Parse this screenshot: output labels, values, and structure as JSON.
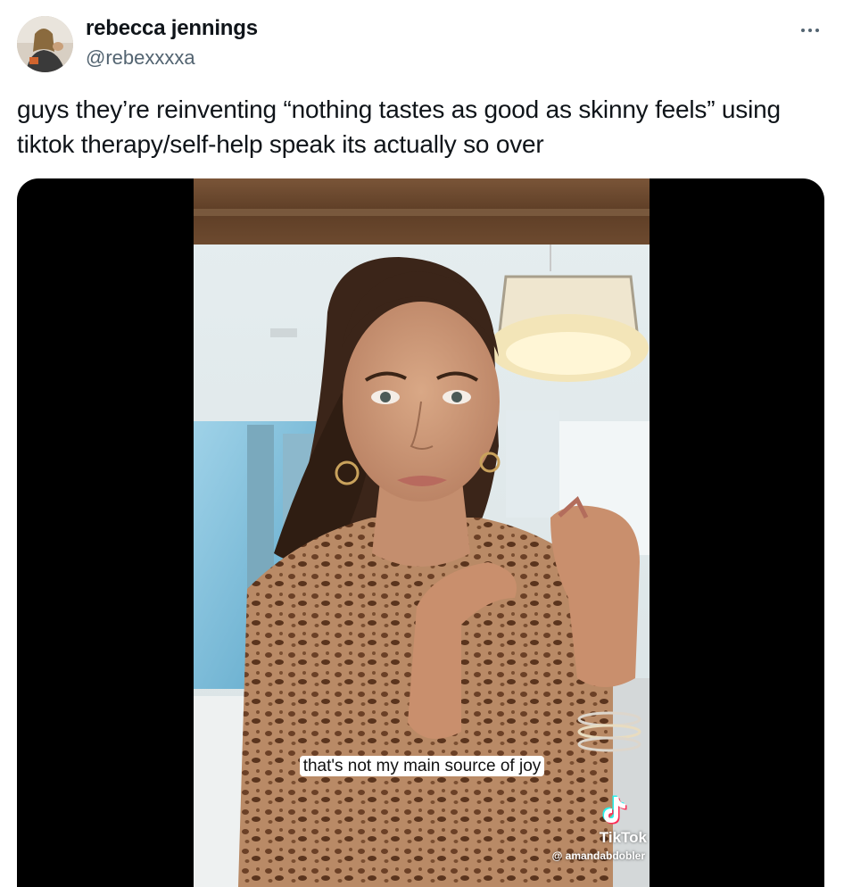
{
  "author": {
    "display_name": "rebecca jennings",
    "handle": "@rebexxxxa"
  },
  "menu": {
    "icon": "more-horizontal-icon"
  },
  "tweet": {
    "text": "guys they’re reinventing “nothing tastes as good as skinny feels” using tiktok therapy/self-help speak its actually so over"
  },
  "media": {
    "type": "video",
    "caption": "that's not my main source of joy",
    "watermark": {
      "icon": "tiktok-logo-icon",
      "brand": "TikTok",
      "username": "@ amandabdobler"
    }
  },
  "colors": {
    "text_primary": "#0f1419",
    "text_secondary": "#536471",
    "media_background": "#000000"
  }
}
